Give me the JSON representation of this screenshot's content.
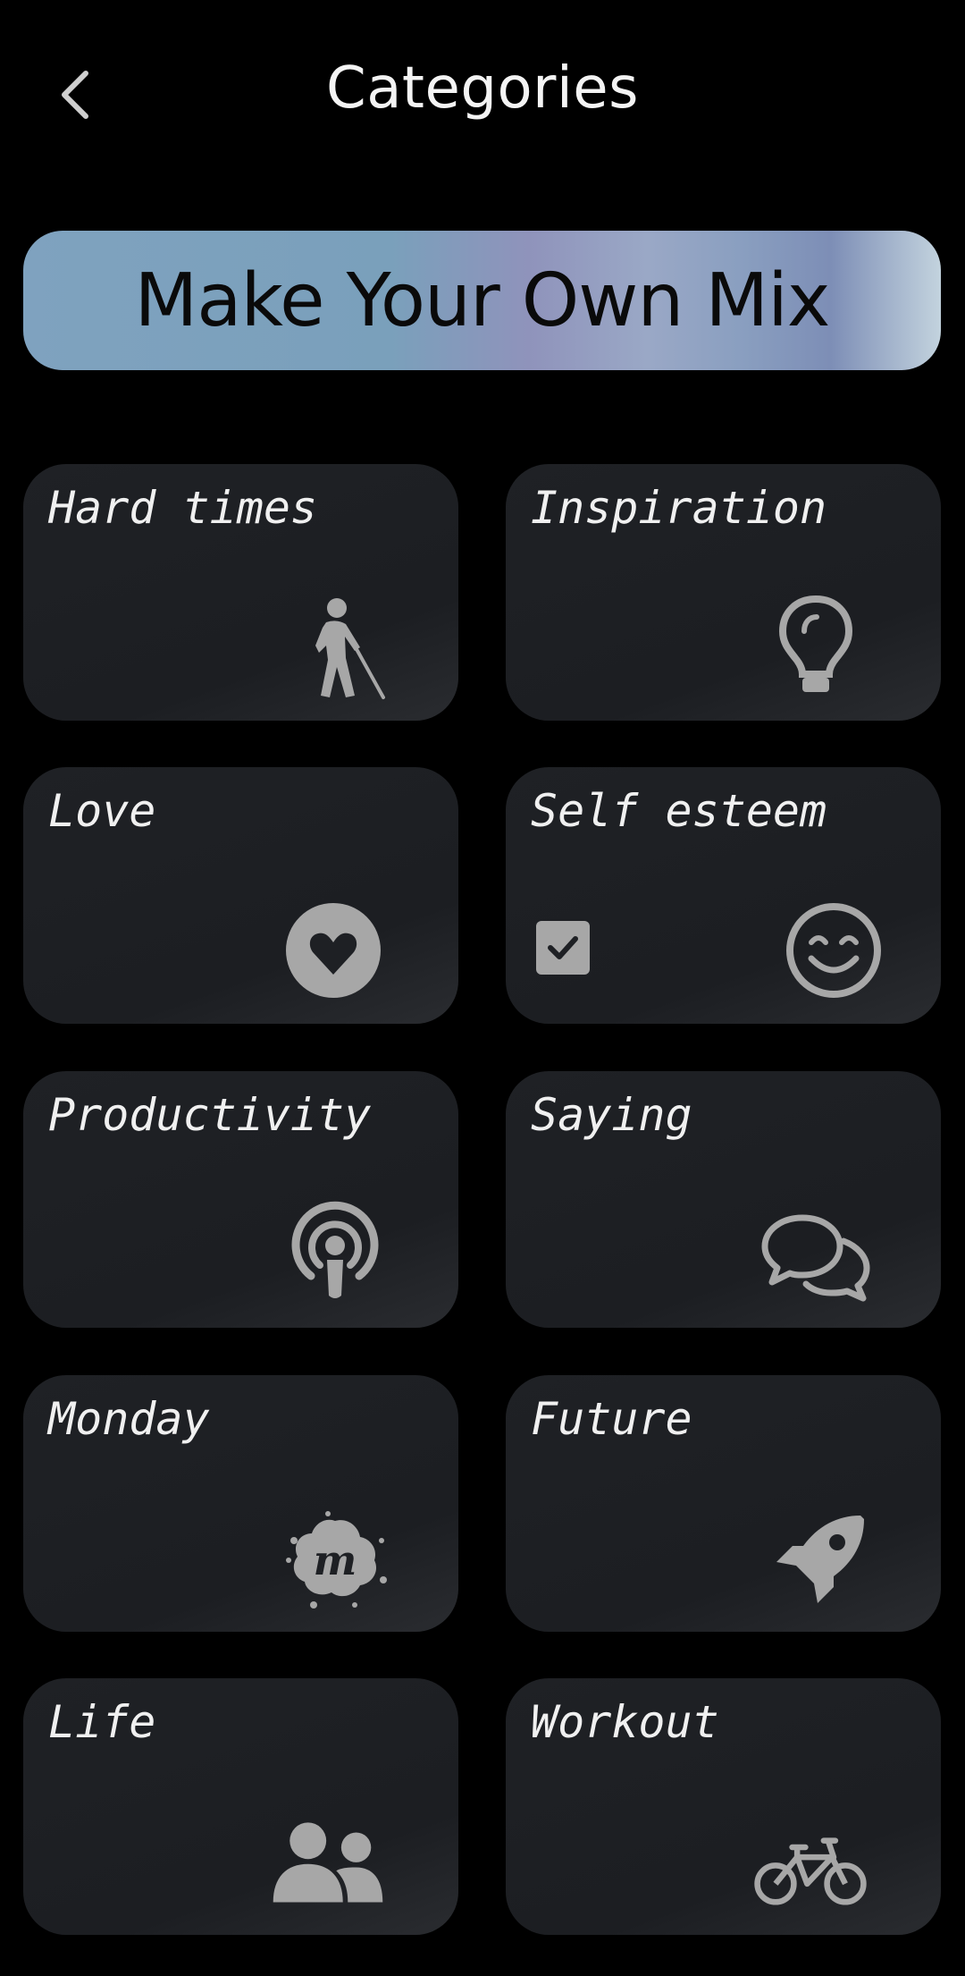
{
  "header": {
    "title": "Categories"
  },
  "banner": {
    "label": "Make Your Own Mix"
  },
  "categories": [
    {
      "label": "Hard times",
      "icon": "blind-person-icon"
    },
    {
      "label": "Inspiration",
      "icon": "lightbulb-icon"
    },
    {
      "label": "Love",
      "icon": "heart-circle-icon"
    },
    {
      "label": "Self esteem",
      "icon": "smile-icon",
      "checked": true
    },
    {
      "label": "Productivity",
      "icon": "podcast-icon"
    },
    {
      "label": "Saying",
      "icon": "speech-bubbles-icon"
    },
    {
      "label": "Monday",
      "icon": "meetup-icon"
    },
    {
      "label": "Future",
      "icon": "rocket-icon"
    },
    {
      "label": "Life",
      "icon": "users-icon"
    },
    {
      "label": "Workout",
      "icon": "bicycle-icon"
    }
  ],
  "colors": {
    "background": "#000000",
    "card": "#1f2125",
    "icon": "#a7a7a7",
    "title_text": "#f4f4f4"
  }
}
